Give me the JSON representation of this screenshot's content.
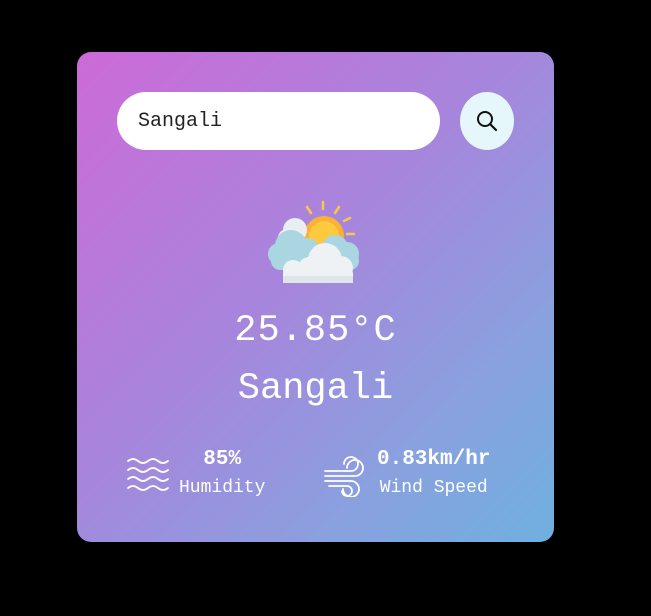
{
  "search": {
    "value": "Sangali",
    "icon": "search-icon"
  },
  "weather": {
    "icon": "partly-cloudy-icon",
    "temperature": "25.85°C",
    "city": "Sangali"
  },
  "humidity": {
    "icon": "humidity-waves-icon",
    "value": "85%",
    "label": "Humidity"
  },
  "wind": {
    "icon": "wind-icon",
    "value": "0.83km/hr",
    "label": "Wind Speed"
  },
  "colors": {
    "background": "#000000",
    "card_gradient_start": "#cd6ad8",
    "card_gradient_end": "#6fb0df",
    "search_button": "#e6f7fb",
    "text": "#ffffff"
  }
}
